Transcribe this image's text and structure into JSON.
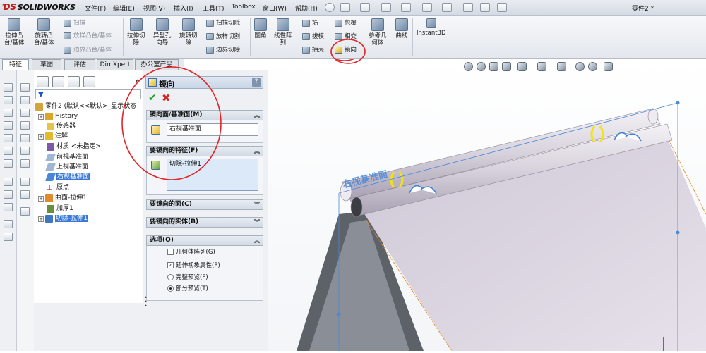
{
  "app": {
    "logo_brand": "SOLIDWORKS",
    "document_title": "零件2 *"
  },
  "menu": [
    "文件(F)",
    "编辑(E)",
    "视图(V)",
    "插入(I)",
    "工具(T)",
    "Toolbox",
    "窗口(W)",
    "帮助(H)"
  ],
  "ribbon": {
    "extrude_boss": "拉伸凸\n台/基体",
    "revolve_boss": "旋转凸\n台/基体",
    "sweep": "扫描",
    "loft_boss": "放样凸台/基体",
    "boundary_boss": "边界凸台/基体",
    "extrude_cut": "拉伸切\n除",
    "hole_wizard": "异型孔\n向导",
    "revolve_cut": "旋转切\n除",
    "sweep_cut": "扫描切除",
    "loft_cut": "放样切割",
    "boundary_cut": "边界切除",
    "fillet": "圆角",
    "linear_pattern": "线性阵\n列",
    "rib": "筋",
    "draft": "拔模",
    "shell": "抽壳",
    "wrap": "包覆",
    "intersect": "相交",
    "mirror": "镜向",
    "ref_geometry": "参考几\n何体",
    "curves": "曲线",
    "instant3d": "Instant3D"
  },
  "tabs": [
    "特征",
    "草图",
    "评估",
    "DimXpert",
    "办公室产品"
  ],
  "tree": {
    "root": "零件2 (默认<<默认>_显示状态",
    "items": [
      {
        "label": "History",
        "expand": true,
        "color": "#d9a629"
      },
      {
        "label": "传感器",
        "expand": false,
        "color": "#e6c34a"
      },
      {
        "label": "注解",
        "expand": true,
        "color": "#e0b92c"
      },
      {
        "label": "材质 <未指定>",
        "expand": false,
        "color": "#7c5aa8"
      },
      {
        "label": "前视基准面",
        "expand": false,
        "color": "#9fb6d4"
      },
      {
        "label": "上视基准面",
        "expand": false,
        "color": "#9fb6d4"
      },
      {
        "label": "右视基准面",
        "expand": false,
        "color": "#4a86d6",
        "selected": true
      },
      {
        "label": "原点",
        "expand": false,
        "color": "#c03030"
      },
      {
        "label": "曲面-拉伸1",
        "expand": true,
        "color": "#e08a2a"
      },
      {
        "label": "加厚1",
        "expand": false,
        "color": "#6a8f3c"
      },
      {
        "label": "切除-拉伸1",
        "expand": true,
        "color": "#3f76c4",
        "selected": true
      }
    ]
  },
  "property_manager": {
    "title": "镜向",
    "help": "?",
    "sections": {
      "mirror_face": {
        "title": "镜向面/基准面(M)",
        "value": "右视基准面"
      },
      "features": {
        "title": "要镜向的特征(F)",
        "value": "切除-拉伸1"
      },
      "faces": {
        "title": "要镜向的面(C)"
      },
      "bodies": {
        "title": "要镜向的实体(B)"
      },
      "options": {
        "title": "选项(O)",
        "geometry_pattern": "几何体阵列(G)",
        "propagate_visual": "延伸视象属性(P)",
        "full_preview": "完整预览(F)",
        "partial_preview": "部分预览(T)"
      }
    }
  },
  "viewport": {
    "plane_label": "右视基准面"
  },
  "colors": {
    "accent_red": "#e0262a",
    "selection_blue": "#3a78d8",
    "highlight_yellow": "#f2e21a"
  }
}
